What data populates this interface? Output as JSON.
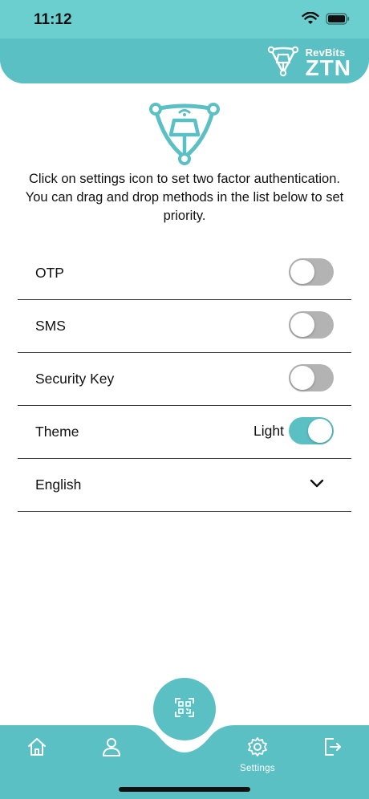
{
  "status_bar": {
    "time": "11:12"
  },
  "brand": {
    "sub": "RevBits",
    "main": "ZTN"
  },
  "intro": {
    "line1": "Click on settings icon to set two factor authentication.",
    "line2": "You can drag and drop methods in the list below to set priority."
  },
  "settings": {
    "otp": {
      "label": "OTP",
      "enabled": false
    },
    "sms": {
      "label": "SMS",
      "enabled": false
    },
    "security_key": {
      "label": "Security Key",
      "enabled": false
    },
    "theme": {
      "label": "Theme",
      "value": "Light",
      "enabled": true
    },
    "language": {
      "selected": "English"
    }
  },
  "nav": {
    "settings_label": "Settings"
  },
  "colors": {
    "accent": "#5bc0c4",
    "header": "#6ccfcf",
    "toggle_off": "#b3b3b3"
  },
  "icons": [
    "wifi-icon",
    "battery-icon",
    "revbits-logo-icon",
    "qr-scan-icon",
    "home-icon",
    "user-icon",
    "gear-icon",
    "logout-icon",
    "chevron-down-icon"
  ]
}
